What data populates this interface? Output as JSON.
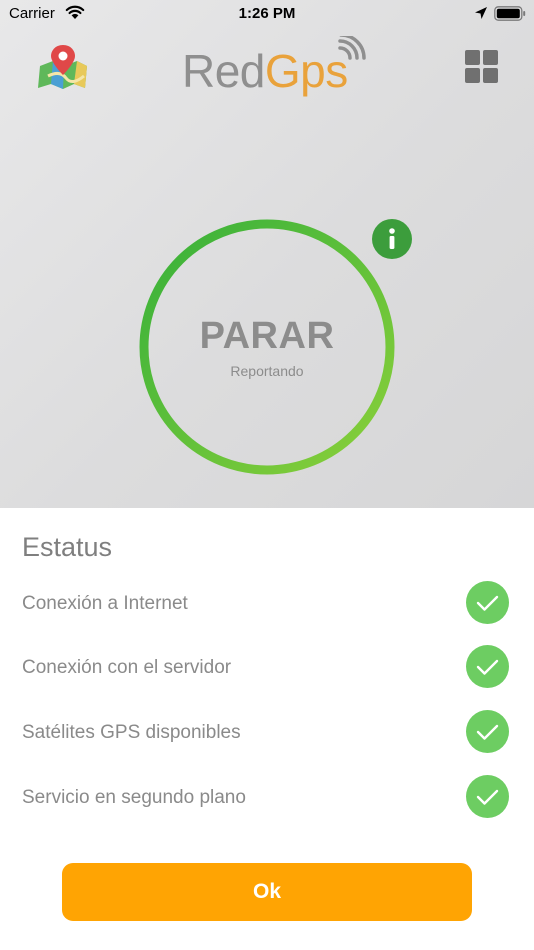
{
  "status_bar": {
    "carrier": "Carrier",
    "time": "1:26 PM"
  },
  "header": {
    "logo_part1": "Red",
    "logo_part2": "Gps",
    "map_icon": "map-pin-icon",
    "menu_icon": "grid-menu-icon"
  },
  "report": {
    "action_label": "PARAR",
    "state_label": "Reportando",
    "info_icon": "info-icon"
  },
  "status": {
    "title": "Estatus",
    "items": [
      {
        "label": "Conexión a Internet",
        "ok": true
      },
      {
        "label": "Conexión con el servidor",
        "ok": true
      },
      {
        "label": "Satélites GPS disponibles",
        "ok": true
      },
      {
        "label": "Servicio en segundo plano",
        "ok": true
      }
    ]
  },
  "ok_button": {
    "label": "Ok"
  },
  "colors": {
    "accent": "#ffa403",
    "ok_green": "#6dcd62",
    "ring_green_start": "#36b03a",
    "ring_green_end": "#8bd03a",
    "logo_orange": "#e9a23b",
    "logo_gray": "#8f8f8f"
  }
}
